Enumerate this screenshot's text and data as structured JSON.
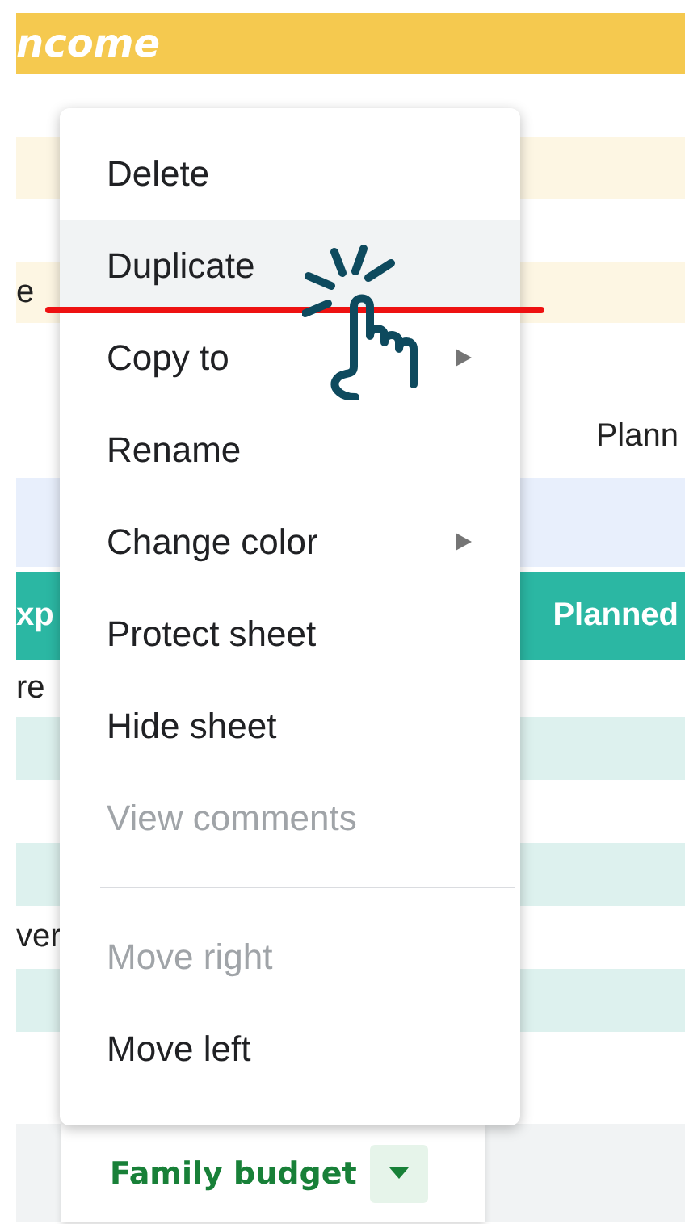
{
  "sheet": {
    "rows": [
      {
        "kind": "gap"
      },
      {
        "kind": "title",
        "left": "ncome"
      },
      {
        "kind": "plain"
      },
      {
        "kind": "stripe_yellow"
      },
      {
        "kind": "plain"
      },
      {
        "kind": "stripe_yellow",
        "left": "e"
      },
      {
        "kind": "tall",
        "right": "Plann"
      },
      {
        "kind": "blue"
      },
      {
        "kind": "header",
        "left": "xp",
        "right": "Planned"
      },
      {
        "kind": "plain_short",
        "left": "re"
      },
      {
        "kind": "stripe_teal"
      },
      {
        "kind": "plain"
      },
      {
        "kind": "stripe_teal"
      },
      {
        "kind": "plain",
        "left": "ver"
      },
      {
        "kind": "stripe_teal"
      },
      {
        "kind": "plain_end"
      }
    ]
  },
  "menu": {
    "items": [
      {
        "kind": "item",
        "label": "Delete",
        "selected": false,
        "disabled": false,
        "submenu": false
      },
      {
        "kind": "item",
        "label": "Duplicate",
        "selected": true,
        "disabled": false,
        "submenu": false
      },
      {
        "kind": "item",
        "label": "Copy to",
        "selected": false,
        "disabled": false,
        "submenu": true
      },
      {
        "kind": "item",
        "label": "Rename",
        "selected": false,
        "disabled": false,
        "submenu": false
      },
      {
        "kind": "item",
        "label": "Change color",
        "selected": false,
        "disabled": false,
        "submenu": true
      },
      {
        "kind": "item",
        "label": "Protect sheet",
        "selected": false,
        "disabled": false,
        "submenu": false
      },
      {
        "kind": "item",
        "label": "Hide sheet",
        "selected": false,
        "disabled": false,
        "submenu": false
      },
      {
        "kind": "item",
        "label": "View comments",
        "selected": false,
        "disabled": true,
        "submenu": false
      },
      {
        "kind": "divider"
      },
      {
        "kind": "item",
        "label": "Move right",
        "selected": false,
        "disabled": true,
        "submenu": false
      },
      {
        "kind": "item",
        "label": "Move left",
        "selected": false,
        "disabled": false,
        "submenu": false
      }
    ]
  },
  "sheet_tab": {
    "label": "Family budget",
    "selected": true
  }
}
